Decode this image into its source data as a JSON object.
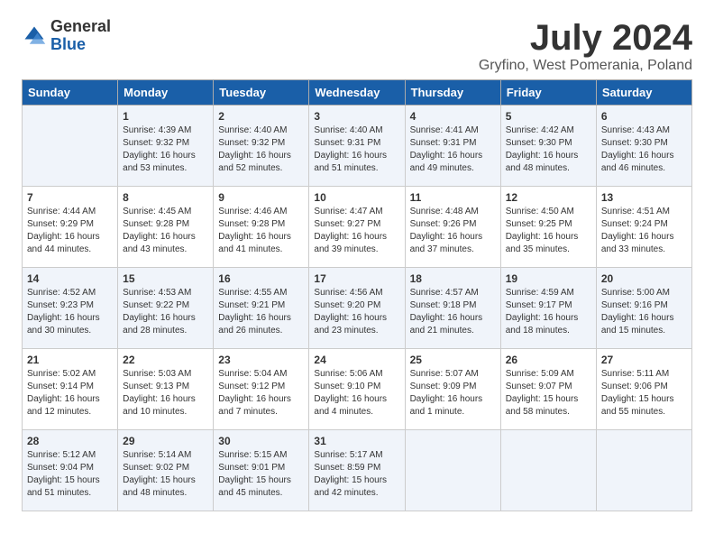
{
  "logo": {
    "general": "General",
    "blue": "Blue"
  },
  "title": "July 2024",
  "location": "Gryfino, West Pomerania, Poland",
  "days_of_week": [
    "Sunday",
    "Monday",
    "Tuesday",
    "Wednesday",
    "Thursday",
    "Friday",
    "Saturday"
  ],
  "weeks": [
    [
      {
        "day": "",
        "info": ""
      },
      {
        "day": "1",
        "info": "Sunrise: 4:39 AM\nSunset: 9:32 PM\nDaylight: 16 hours\nand 53 minutes."
      },
      {
        "day": "2",
        "info": "Sunrise: 4:40 AM\nSunset: 9:32 PM\nDaylight: 16 hours\nand 52 minutes."
      },
      {
        "day": "3",
        "info": "Sunrise: 4:40 AM\nSunset: 9:31 PM\nDaylight: 16 hours\nand 51 minutes."
      },
      {
        "day": "4",
        "info": "Sunrise: 4:41 AM\nSunset: 9:31 PM\nDaylight: 16 hours\nand 49 minutes."
      },
      {
        "day": "5",
        "info": "Sunrise: 4:42 AM\nSunset: 9:30 PM\nDaylight: 16 hours\nand 48 minutes."
      },
      {
        "day": "6",
        "info": "Sunrise: 4:43 AM\nSunset: 9:30 PM\nDaylight: 16 hours\nand 46 minutes."
      }
    ],
    [
      {
        "day": "7",
        "info": "Sunrise: 4:44 AM\nSunset: 9:29 PM\nDaylight: 16 hours\nand 44 minutes."
      },
      {
        "day": "8",
        "info": "Sunrise: 4:45 AM\nSunset: 9:28 PM\nDaylight: 16 hours\nand 43 minutes."
      },
      {
        "day": "9",
        "info": "Sunrise: 4:46 AM\nSunset: 9:28 PM\nDaylight: 16 hours\nand 41 minutes."
      },
      {
        "day": "10",
        "info": "Sunrise: 4:47 AM\nSunset: 9:27 PM\nDaylight: 16 hours\nand 39 minutes."
      },
      {
        "day": "11",
        "info": "Sunrise: 4:48 AM\nSunset: 9:26 PM\nDaylight: 16 hours\nand 37 minutes."
      },
      {
        "day": "12",
        "info": "Sunrise: 4:50 AM\nSunset: 9:25 PM\nDaylight: 16 hours\nand 35 minutes."
      },
      {
        "day": "13",
        "info": "Sunrise: 4:51 AM\nSunset: 9:24 PM\nDaylight: 16 hours\nand 33 minutes."
      }
    ],
    [
      {
        "day": "14",
        "info": "Sunrise: 4:52 AM\nSunset: 9:23 PM\nDaylight: 16 hours\nand 30 minutes."
      },
      {
        "day": "15",
        "info": "Sunrise: 4:53 AM\nSunset: 9:22 PM\nDaylight: 16 hours\nand 28 minutes."
      },
      {
        "day": "16",
        "info": "Sunrise: 4:55 AM\nSunset: 9:21 PM\nDaylight: 16 hours\nand 26 minutes."
      },
      {
        "day": "17",
        "info": "Sunrise: 4:56 AM\nSunset: 9:20 PM\nDaylight: 16 hours\nand 23 minutes."
      },
      {
        "day": "18",
        "info": "Sunrise: 4:57 AM\nSunset: 9:18 PM\nDaylight: 16 hours\nand 21 minutes."
      },
      {
        "day": "19",
        "info": "Sunrise: 4:59 AM\nSunset: 9:17 PM\nDaylight: 16 hours\nand 18 minutes."
      },
      {
        "day": "20",
        "info": "Sunrise: 5:00 AM\nSunset: 9:16 PM\nDaylight: 16 hours\nand 15 minutes."
      }
    ],
    [
      {
        "day": "21",
        "info": "Sunrise: 5:02 AM\nSunset: 9:14 PM\nDaylight: 16 hours\nand 12 minutes."
      },
      {
        "day": "22",
        "info": "Sunrise: 5:03 AM\nSunset: 9:13 PM\nDaylight: 16 hours\nand 10 minutes."
      },
      {
        "day": "23",
        "info": "Sunrise: 5:04 AM\nSunset: 9:12 PM\nDaylight: 16 hours\nand 7 minutes."
      },
      {
        "day": "24",
        "info": "Sunrise: 5:06 AM\nSunset: 9:10 PM\nDaylight: 16 hours\nand 4 minutes."
      },
      {
        "day": "25",
        "info": "Sunrise: 5:07 AM\nSunset: 9:09 PM\nDaylight: 16 hours\nand 1 minute."
      },
      {
        "day": "26",
        "info": "Sunrise: 5:09 AM\nSunset: 9:07 PM\nDaylight: 15 hours\nand 58 minutes."
      },
      {
        "day": "27",
        "info": "Sunrise: 5:11 AM\nSunset: 9:06 PM\nDaylight: 15 hours\nand 55 minutes."
      }
    ],
    [
      {
        "day": "28",
        "info": "Sunrise: 5:12 AM\nSunset: 9:04 PM\nDaylight: 15 hours\nand 51 minutes."
      },
      {
        "day": "29",
        "info": "Sunrise: 5:14 AM\nSunset: 9:02 PM\nDaylight: 15 hours\nand 48 minutes."
      },
      {
        "day": "30",
        "info": "Sunrise: 5:15 AM\nSunset: 9:01 PM\nDaylight: 15 hours\nand 45 minutes."
      },
      {
        "day": "31",
        "info": "Sunrise: 5:17 AM\nSunset: 8:59 PM\nDaylight: 15 hours\nand 42 minutes."
      },
      {
        "day": "",
        "info": ""
      },
      {
        "day": "",
        "info": ""
      },
      {
        "day": "",
        "info": ""
      }
    ]
  ]
}
